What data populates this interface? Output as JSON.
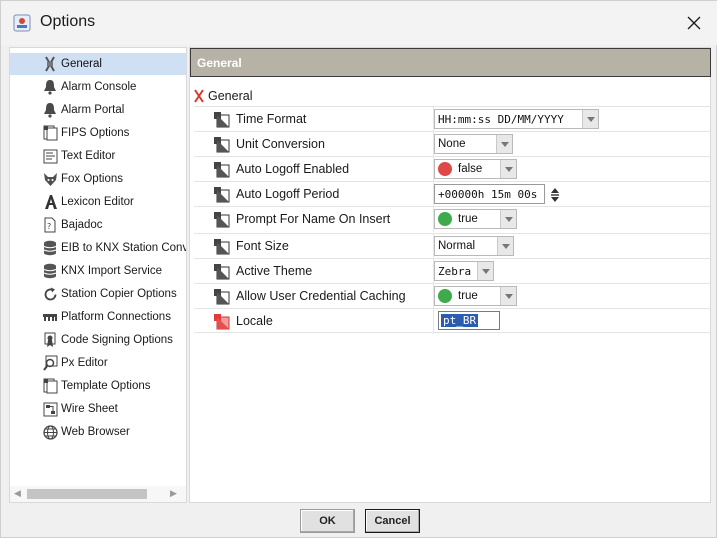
{
  "window": {
    "title": "Options"
  },
  "sidebar": {
    "items": [
      {
        "label": "General",
        "icon": "general-icon",
        "selected": true
      },
      {
        "label": "Alarm Console",
        "icon": "bell-icon"
      },
      {
        "label": "Alarm Portal",
        "icon": "bell-icon"
      },
      {
        "label": "FIPS Options",
        "icon": "document-icon"
      },
      {
        "label": "Text Editor",
        "icon": "text-editor-icon"
      },
      {
        "label": "Fox Options",
        "icon": "fox-icon"
      },
      {
        "label": "Lexicon Editor",
        "icon": "lexicon-icon"
      },
      {
        "label": "Bajadoc",
        "icon": "bajadoc-icon"
      },
      {
        "label": "EIB to KNX Station Conve",
        "icon": "database-icon"
      },
      {
        "label": "KNX Import Service",
        "icon": "database-icon"
      },
      {
        "label": "Station Copier Options",
        "icon": "refresh-icon"
      },
      {
        "label": "Platform Connections",
        "icon": "connections-icon"
      },
      {
        "label": "Code Signing Options",
        "icon": "certificate-icon"
      },
      {
        "label": "Px Editor",
        "icon": "px-editor-icon"
      },
      {
        "label": "Template Options",
        "icon": "document-icon"
      },
      {
        "label": "Wire Sheet",
        "icon": "wire-sheet-icon"
      },
      {
        "label": "Web Browser",
        "icon": "globe-icon"
      }
    ]
  },
  "main": {
    "header": "General",
    "tree_root": "General",
    "properties": [
      {
        "name": "Time Format",
        "value": "HH:mm:ss DD/MM/YYYY",
        "kind": "dropdown"
      },
      {
        "name": "Unit Conversion",
        "value": "None",
        "kind": "dropdown"
      },
      {
        "name": "Auto Logoff Enabled",
        "value": "false",
        "kind": "bool-dropdown",
        "status_color": "#e04848"
      },
      {
        "name": "Auto Logoff Period",
        "value": "+00000h 15m 00s",
        "kind": "spinner"
      },
      {
        "name": "Prompt For Name On Insert",
        "value": "true",
        "kind": "bool-dropdown",
        "status_color": "#3faa4a"
      },
      {
        "name": "Font Size",
        "value": "Normal",
        "kind": "dropdown"
      },
      {
        "name": "Active Theme",
        "value": "Zebra",
        "kind": "dropdown"
      },
      {
        "name": "Allow User Credential Caching",
        "value": "true",
        "kind": "bool-dropdown",
        "status_color": "#3faa4a"
      },
      {
        "name": "Locale",
        "value": "pt_BR",
        "kind": "text-input"
      }
    ]
  },
  "buttons": {
    "ok": "OK",
    "cancel": "Cancel"
  },
  "colors": {
    "selection": "#cfe0f5",
    "header_bg": "#b6b3a6",
    "accent_red": "#e04848",
    "accent_green": "#3faa4a"
  }
}
